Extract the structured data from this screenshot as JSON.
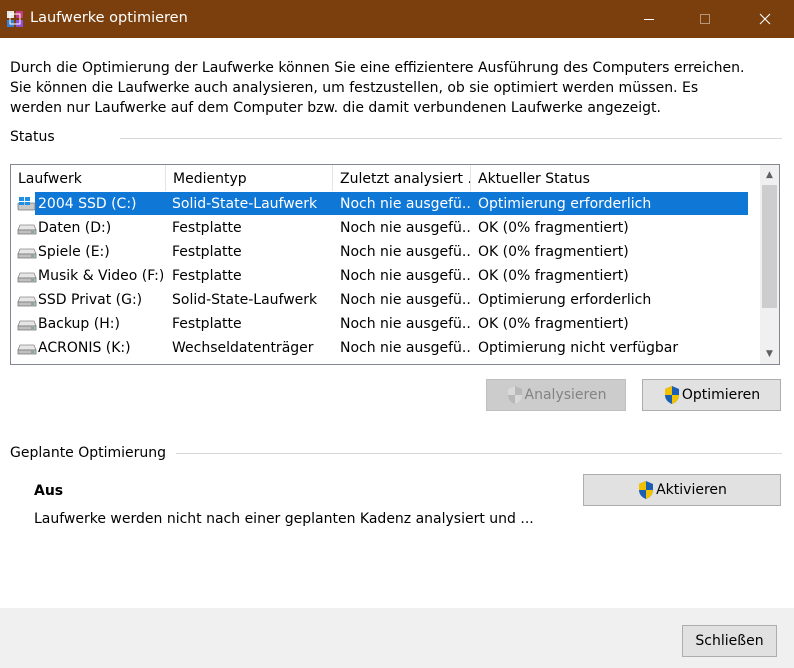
{
  "window": {
    "title": "Laufwerke optimieren",
    "app_icon": "defrag-icon",
    "controls": [
      "minimize-icon",
      "maximize-icon",
      "close-icon"
    ],
    "accent_color": "#7a3f0d"
  },
  "intro_text": "Durch die Optimierung der Laufwerke können Sie eine effizientere Ausführung des Computers erreichen. Sie können die Laufwerke auch analysieren, um festzustellen, ob sie optimiert werden müssen. Es werden nur Laufwerke auf dem Computer bzw. die damit verbundenen Laufwerke angezeigt.",
  "status": {
    "label": "Status",
    "columns": [
      "Laufwerk",
      "Medientyp",
      "Zuletzt analysiert ...",
      "Aktueller Status"
    ],
    "rows": [
      {
        "drive": "2004 SSD (C:)",
        "media": "Solid-State-Laufwerk",
        "last": "Noch nie ausgefü...",
        "state": "Optimierung erforderlich",
        "icon": "windows-drive-icon",
        "selected": true
      },
      {
        "drive": "Daten (D:)",
        "media": "Festplatte",
        "last": "Noch nie ausgefü...",
        "state": "OK (0% fragmentiert)",
        "icon": "drive-icon",
        "selected": false
      },
      {
        "drive": "Spiele (E:)",
        "media": "Festplatte",
        "last": "Noch nie ausgefü...",
        "state": "OK (0% fragmentiert)",
        "icon": "drive-icon",
        "selected": false
      },
      {
        "drive": "Musik & Video (F:)",
        "media": "Festplatte",
        "last": "Noch nie ausgefü...",
        "state": "OK (0% fragmentiert)",
        "icon": "drive-icon",
        "selected": false
      },
      {
        "drive": "SSD Privat (G:)",
        "media": "Solid-State-Laufwerk",
        "last": "Noch nie ausgefü...",
        "state": "Optimierung erforderlich",
        "icon": "drive-icon",
        "selected": false
      },
      {
        "drive": "Backup (H:)",
        "media": "Festplatte",
        "last": "Noch nie ausgefü...",
        "state": "OK (0% fragmentiert)",
        "icon": "drive-icon",
        "selected": false
      },
      {
        "drive": "ACRONIS (K:)",
        "media": "Wechseldatenträger",
        "last": "Noch nie ausgefü...",
        "state": "Optimierung nicht verfügbar",
        "icon": "drive-icon",
        "selected": false
      }
    ],
    "analyze_button": "Analysieren",
    "optimize_button": "Optimieren"
  },
  "schedule": {
    "label": "Geplante Optimierung",
    "state": "Aus",
    "description": "Laufwerke werden nicht nach einer geplanten Kadenz analysiert und ...",
    "activate_button": "Aktivieren"
  },
  "footer": {
    "close_button": "Schließen"
  },
  "colors": {
    "selection": "#0f78d7",
    "shield_blue": "#1a5fb4",
    "shield_yellow": "#f2c200"
  }
}
